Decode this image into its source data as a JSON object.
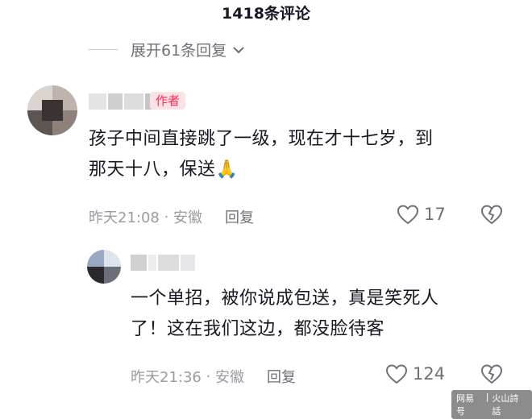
{
  "header": {
    "title": "1418条评论"
  },
  "expand": {
    "label": "展开61条回复"
  },
  "comment1": {
    "author_badge": "作者",
    "text_line1": "孩子中间直接跳了一级，现在才十七岁，到",
    "text_line2": "那天十八，保送",
    "emoji": "🙏",
    "time": "昨天21:08",
    "location": "安徽",
    "reply_label": "回复",
    "likes": "17"
  },
  "comment2": {
    "text_line1": "一个单招，被你说成包送，真是笑死人",
    "text_line2": "了！这在我们这边，都没脸待客",
    "time": "昨天21:36",
    "location": "安徽",
    "reply_label": "回复",
    "likes": "124"
  },
  "watermark": {
    "left": "网易号",
    "right": "火山詩話"
  },
  "colors": {
    "accent": "#fe2c55",
    "badge_bg": "#fde1e4",
    "muted": "#9a9ba3",
    "text": "#161823"
  }
}
